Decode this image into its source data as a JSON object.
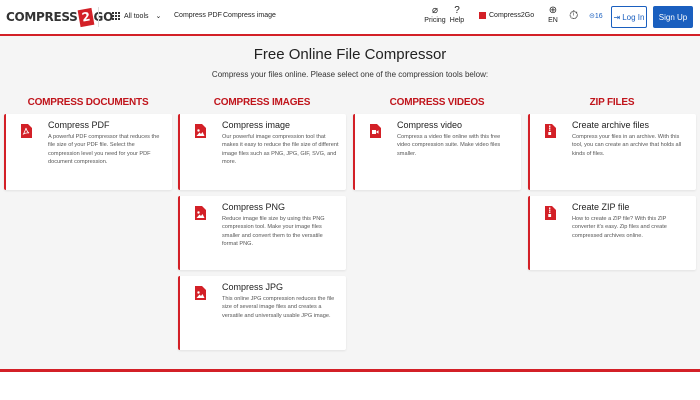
{
  "header": {
    "logo": {
      "left": "COMPRESS",
      "middle": "2",
      "right": "GO"
    },
    "all_tools": "All tools",
    "nav": [
      "Compress PDF",
      "Compress image"
    ],
    "pricing": "Pricing",
    "help": "Help",
    "brand_link": "Compress2Go",
    "language": "EN",
    "credits": "16",
    "login": "Log In",
    "signup": "Sign Up"
  },
  "main": {
    "title": "Free Online File Compressor",
    "subtitle": "Compress your files online. Please select one of the compression tools below:"
  },
  "columns": [
    {
      "heading": "COMPRESS DOCUMENTS",
      "cards": [
        {
          "title": "Compress PDF",
          "desc": "A powerful PDF compressor that reduces the file size of your PDF file. Select the compression level you need for your PDF document compression.",
          "icon": "pdf-file-icon"
        }
      ]
    },
    {
      "heading": "COMPRESS IMAGES",
      "cards": [
        {
          "title": "Compress image",
          "desc": "Our powerful image compression tool that makes it easy to reduce the file size of different image files such as PNG, JPG, GIF, SVG, and more.",
          "icon": "image-file-icon"
        },
        {
          "title": "Compress PNG",
          "desc": "Reduce image file size by using this PNG compression tool. Make your image files smaller and convert them to the versatile format PNG.",
          "icon": "image-file-icon"
        },
        {
          "title": "Compress JPG",
          "desc": "This online JPG compression reduces the file size of several image files and creates a versatile and universally usable JPG image.",
          "icon": "image-file-icon"
        }
      ]
    },
    {
      "heading": "COMPRESS VIDEOS",
      "cards": [
        {
          "title": "Compress video",
          "desc": "Compress a video file online with this free video compression suite. Make video files smaller.",
          "icon": "video-file-icon"
        }
      ]
    },
    {
      "heading": "ZIP FILES",
      "cards": [
        {
          "title": "Create archive files",
          "desc": "Compress your files in an archive. With this tool, you can create an archive that holds all kinds of files.",
          "icon": "archive-file-icon"
        },
        {
          "title": "Create ZIP file",
          "desc": "How to create a ZIP file? With this ZIP converter it's easy. Zip files and create compressed archives online.",
          "icon": "zip-file-icon"
        }
      ]
    }
  ],
  "colors": {
    "accent": "#d32027",
    "link_blue": "#1a5fbf",
    "background": "#f5f5f5"
  }
}
